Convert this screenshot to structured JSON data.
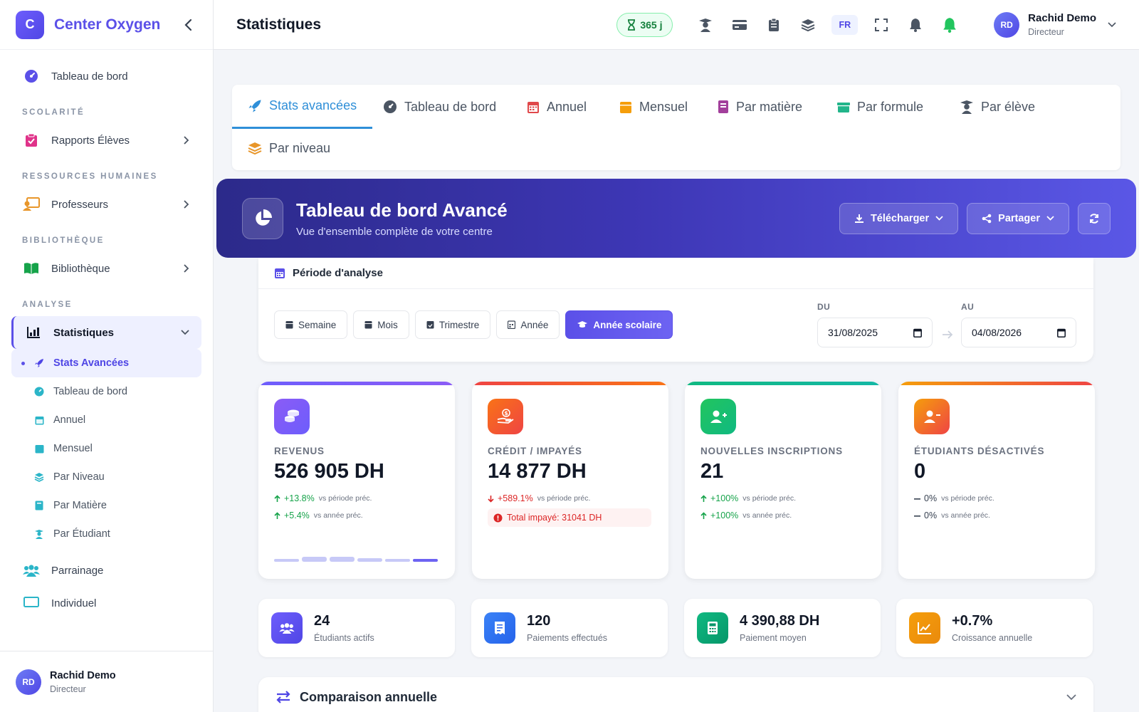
{
  "sidebar": {
    "brand_letter": "C",
    "brand_name": "Center Oxygen",
    "top_item": "Tableau de bord",
    "sections": {
      "scolarite": "SCOLARITÉ",
      "rh": "RESSOURCES HUMAINES",
      "bibliotheque": "BIBLIOTHÈQUE",
      "analyse": "ANALYSE"
    },
    "items": {
      "rapports": "Rapports Élèves",
      "professeurs": "Professeurs",
      "bibliotheque": "Bibliothèque",
      "statistiques": "Statistiques",
      "parrainage": "Parrainage",
      "individuel": "Individuel"
    },
    "sub_items": [
      "Stats Avancées",
      "Tableau de bord",
      "Annuel",
      "Mensuel",
      "Par Niveau",
      "Par Matière",
      "Par Étudiant"
    ],
    "user": {
      "initials": "RD",
      "name": "Rachid Demo",
      "role": "Directeur"
    }
  },
  "header": {
    "title": "Statistiques",
    "days_badge": "365 j",
    "lang": "FR",
    "user": {
      "initials": "RD",
      "name": "Rachid Demo",
      "role": "Directeur"
    }
  },
  "tabs": [
    "Stats avancées",
    "Tableau de bord",
    "Annuel",
    "Mensuel",
    "Par matière",
    "Par formule",
    "Par élève",
    "Par niveau"
  ],
  "hero": {
    "title": "Tableau de bord Avancé",
    "subtitle": "Vue d'ensemble complète de votre centre",
    "download_label": "Télécharger",
    "share_label": "Partager"
  },
  "period": {
    "title": "Période d'analyse",
    "buttons": [
      "Semaine",
      "Mois",
      "Trimestre",
      "Année",
      "Année scolaire"
    ],
    "active": "Année scolaire",
    "from_label": "DU",
    "from_value": "31/08/2025",
    "to_label": "AU",
    "to_value": "04/08/2026"
  },
  "stats": [
    {
      "label": "REVENUS",
      "value": "526 905 DH",
      "trend1": "+13.8%",
      "cmp1": "vs période préc.",
      "trend2": "+5.4%",
      "cmp2": "vs année préc."
    },
    {
      "label": "CRÉDIT / IMPAYÉS",
      "value": "14 877 DH",
      "trend1": "+589.1%",
      "cmp1": "vs période préc.",
      "unpaid": "Total impayé: 31041 DH"
    },
    {
      "label": "NOUVELLES INSCRIPTIONS",
      "value": "21",
      "trend1": "+100%",
      "cmp1": "vs période préc.",
      "trend2": "+100%",
      "cmp2": "vs année préc."
    },
    {
      "label": "ÉTUDIANTS DÉSACTIVÉS",
      "value": "0",
      "trend1": "0%",
      "cmp1": "vs période préc.",
      "trend2": "0%",
      "cmp2": "vs année préc."
    }
  ],
  "mini": [
    {
      "value": "24",
      "label": "Étudiants actifs"
    },
    {
      "value": "120",
      "label": "Paiements effectués"
    },
    {
      "value": "4 390,88 DH",
      "label": "Paiement moyen"
    },
    {
      "value": "+0.7%",
      "label": "Croissance annuelle"
    }
  ],
  "accordion": {
    "title": "Comparaison annuelle"
  },
  "colors": {
    "primary": "#5b50e8",
    "tab_active": "#2f8fd8",
    "up": "#16a34a",
    "down": "#dc2626"
  }
}
